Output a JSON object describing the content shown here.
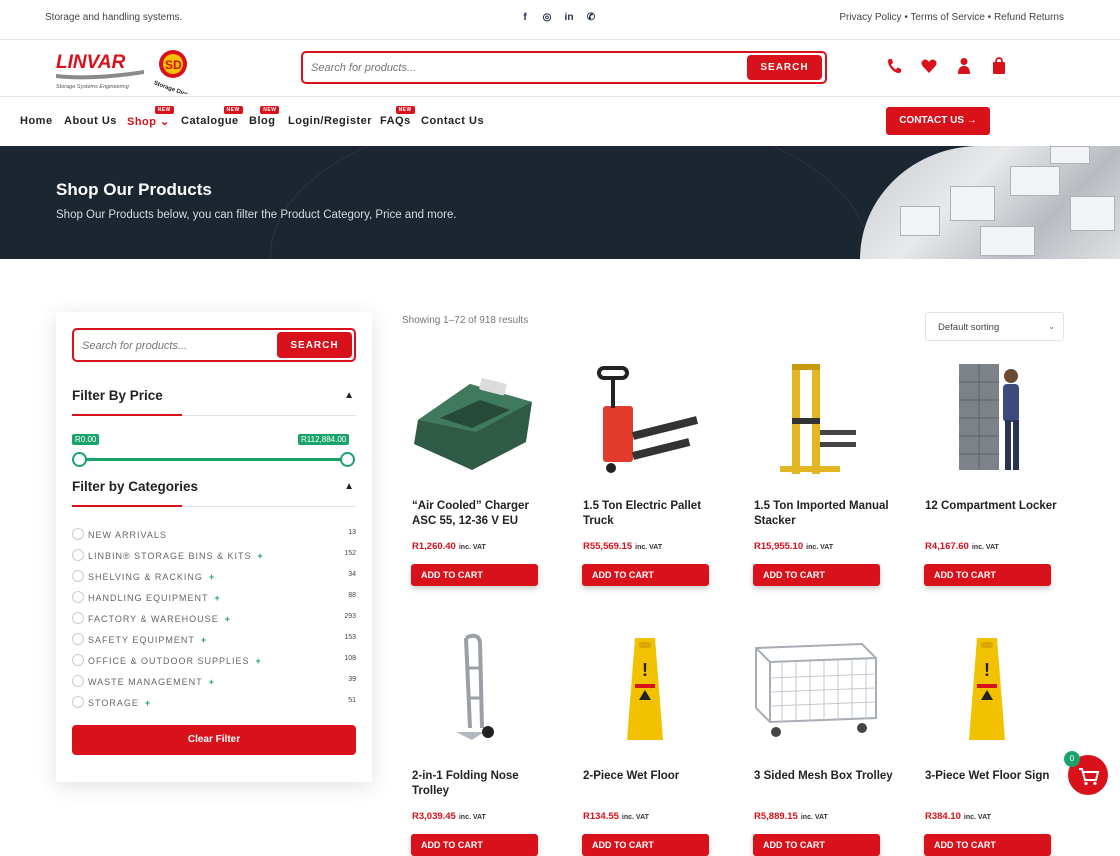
{
  "topbar": {
    "tagline": "Storage and handling systems.",
    "socials": [
      "facebook-icon",
      "instagram-icon",
      "linkedin-icon",
      "whatsapp-icon"
    ],
    "legal": "Privacy Policy • Terms of Service • Refund Returns"
  },
  "header": {
    "logo_text": "LINVAR",
    "logo_tagline": "Storage Systems Engineering",
    "badge_text": "SD",
    "badge_subtitle": "Storage Direct",
    "search_placeholder": "Search for products...",
    "search_label": "SEARCH",
    "icons": [
      "phone-icon",
      "heart-icon",
      "user-icon",
      "shopping-bag-icon"
    ]
  },
  "nav": {
    "items": [
      {
        "label": "Home"
      },
      {
        "label": "About Us"
      },
      {
        "label": "Shop ⌄",
        "badge": "NEW"
      },
      {
        "label": "Catalogue",
        "badge": "NEW"
      },
      {
        "label": "Blog",
        "badge": "NEW"
      },
      {
        "label": "Login/Register"
      },
      {
        "label": "FAQs",
        "badge": "NEW"
      },
      {
        "label": "Contact Us"
      }
    ],
    "contact_button": "CONTACT US →"
  },
  "hero": {
    "title": "Shop Our Products",
    "subtitle": "Shop Our Products below, you can filter the Product Category, Price and more."
  },
  "sidebar": {
    "search_placeholder": "Search for products...",
    "search_label": "SEARCH",
    "price_heading": "Filter By Price",
    "price_min": "R0.00",
    "price_max": "R112,884.00",
    "categories_heading": "Filter by Categories",
    "categories": [
      {
        "name": "NEW ARRIVALS",
        "plus": "",
        "count": "13"
      },
      {
        "name": "LINBIN® STORAGE BINS & KITS",
        "plus": "+",
        "count": "152"
      },
      {
        "name": "SHELVING & RACKING",
        "plus": "+",
        "count": "34"
      },
      {
        "name": "HANDLING EQUIPMENT",
        "plus": "+",
        "count": "88"
      },
      {
        "name": "FACTORY & WAREHOUSE",
        "plus": "+",
        "count": "293"
      },
      {
        "name": "SAFETY EQUIPMENT",
        "plus": "+",
        "count": "153"
      },
      {
        "name": "OFFICE & OUTDOOR SUPPLIES",
        "plus": "+",
        "count": "108"
      },
      {
        "name": "WASTE MANAGEMENT",
        "plus": "+",
        "count": "39"
      },
      {
        "name": "STORAGE",
        "plus": "+",
        "count": "51"
      }
    ],
    "clear_button": "Clear Filter"
  },
  "shop": {
    "results_text": "Showing 1–72 of 918 results",
    "sorting": "Default sorting",
    "vat_label": "inc. VAT",
    "cart_label": "ADD TO CART",
    "products": [
      {
        "title": "“Air Cooled” Charger ASC 55, 12-36 V EU",
        "price": "R1,260.40"
      },
      {
        "title": "1.5 Ton Electric Pallet Truck",
        "price": "R55,569.15"
      },
      {
        "title": "1.5 Ton Imported Manual Stacker",
        "price": "R15,955.10"
      },
      {
        "title": "12 Compartment Locker",
        "price": "R4,167.60"
      },
      {
        "title": "2-in-1 Folding Nose Trolley",
        "price": "R3,039.45"
      },
      {
        "title": "2-Piece Wet Floor",
        "price": "R134.55"
      },
      {
        "title": "3 Sided Mesh Box Trolley",
        "price": "R5,889.15"
      },
      {
        "title": "3-Piece Wet Floor Sign",
        "price": "R384.10"
      }
    ]
  },
  "floating_cart": {
    "count": "0"
  },
  "colors": {
    "accent": "#d8111b",
    "green": "#1aa36b",
    "hero_bg": "#1c2630"
  }
}
